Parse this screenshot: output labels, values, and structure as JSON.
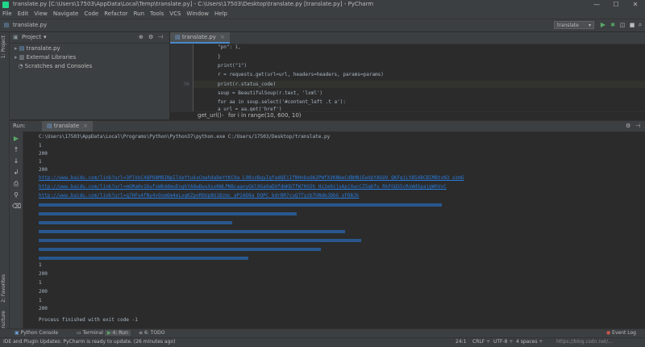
{
  "window": {
    "title": "translate.py [C:\\Users\\17503\\AppData\\Local\\Temp\\translate.py] - C:\\Users\\17503\\Desktop\\translate.py [translate.py] - PyCharm",
    "controls": [
      "—",
      "☐",
      "✕"
    ]
  },
  "menu": [
    "File",
    "Edit",
    "View",
    "Navigate",
    "Code",
    "Refactor",
    "Run",
    "Tools",
    "VCS",
    "Window",
    "Help"
  ],
  "navbar": {
    "breadcrumb": "translate.py",
    "run_config": "translate"
  },
  "left_stripe": {
    "project": "1: Project",
    "favorites": "2: Favorites",
    "structure": "Z: Structure"
  },
  "project": {
    "header": "Project",
    "items": [
      {
        "label": "translate.py",
        "icon": "python-file-icon"
      },
      {
        "label": "External Libraries",
        "icon": "library-icon"
      },
      {
        "label": "Scratches and Consoles",
        "icon": "scratch-icon"
      }
    ]
  },
  "editor": {
    "tab": "translate.py",
    "lines": [
      {
        "num": "",
        "text": "  \"pn\": i,"
      },
      {
        "num": "",
        "text": "}"
      },
      {
        "num": "",
        "text": "print(\"1\")"
      },
      {
        "num": "",
        "text": "r = requests.get(url=url, headers=headers, params=params)"
      },
      {
        "num": "36",
        "text": "print(r.status_code)"
      },
      {
        "num": "",
        "text": "soup = BeautifulSoup(r.text, 'lxml')"
      },
      {
        "num": "",
        "text": "for aa in soup.select('#content_left .t a'):"
      },
      {
        "num": "",
        "text": "    a_url = aa.get('href')"
      }
    ],
    "breadcrumb": [
      "get_url()",
      "for i in range(10, 600, 10)"
    ]
  },
  "run": {
    "label": "Run:",
    "tab": "translate",
    "command": "C:\\Users\\17503\\AppData\\Local\\Programs\\Python\\Python37\\python.exe C:/Users/17503/Desktop/translate.py",
    "lines_before": [
      "1",
      "200",
      "1",
      "200"
    ],
    "links": [
      "http://www.baidu.com/link?url=3PlVoC4QPO8M8INpIlXeYtukxCmahdaDeYtKC9a_L98vzBgyIgfadQEjIfNHnbsOA2PWfXVKNbeCdBHNiEwVpYAGOV_QKFgjLtB5d8CBIMBtvN3_ozmG",
      "http://www.baidu.com/link?url=mGMaHv1bufsW6ddmuEngkYA8wDwsXsxKWLPNBcaanyGkl9Ga9aDUfdmKbTfW7HS5h_Hz2e0zjsApjXwcCZ5q6fu_RkFGQS5cRsWdSpajgWhVvC",
      "http://www.baidu.com/link?url=q7HFu4fNy4vOsmOm4eLxgKZpoRbUp8U1Bzmc_aP2AD8a_DQPC_bdrBR7cuQ7Tyzb7UNdmJDbG_sFDBJk"
    ],
    "lines_after": [
      "1",
      "200",
      "1",
      "200",
      "1",
      "200"
    ],
    "finished": "Process finished with exit code -1"
  },
  "bottom_tabs": [
    "Python Console",
    "Terminal",
    "4: Run",
    "6: TODO"
  ],
  "event_log": "Event Log",
  "status": {
    "message": "IDE and Plugin Updates: PyCharm is ready to update. (26 minutes ago)",
    "position": "24:1",
    "line_sep": "CRLF ÷",
    "encoding": "UTF-8 ÷",
    "indent": "4 spaces ÷",
    "watermark": "https://blog.csdn.net/..."
  },
  "colors": {
    "accent": "#4a88c7",
    "link": "#287bde",
    "run_green": "#59a869",
    "stop_red": "#c75450"
  }
}
